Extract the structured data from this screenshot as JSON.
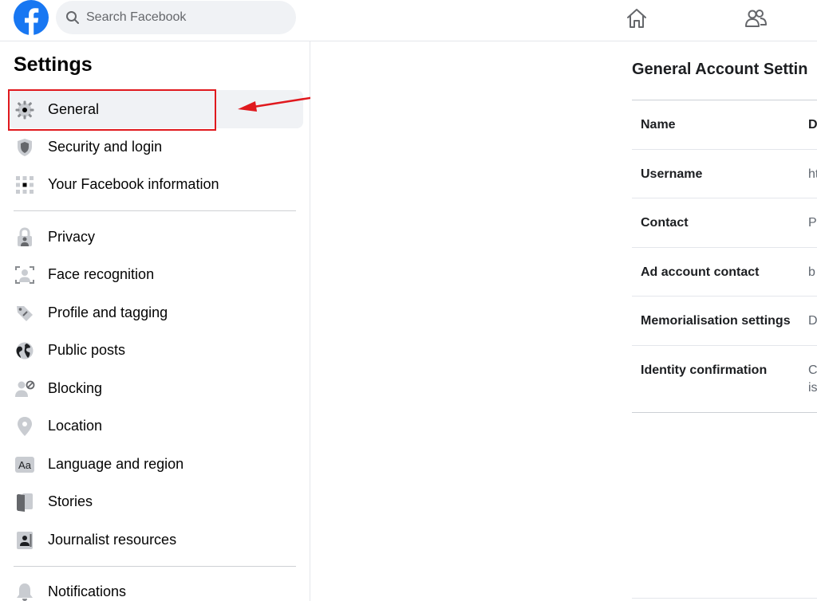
{
  "search": {
    "placeholder": "Search Facebook"
  },
  "sidebar": {
    "title": "Settings",
    "items": [
      {
        "label": "General",
        "icon": "gear-icon"
      },
      {
        "label": "Security and login",
        "icon": "shield-icon"
      },
      {
        "label": "Your Facebook information",
        "icon": "grid-icon"
      },
      {
        "label": "Privacy",
        "icon": "lock-icon"
      },
      {
        "label": "Face recognition",
        "icon": "face-scan-icon"
      },
      {
        "label": "Profile and tagging",
        "icon": "tag-icon"
      },
      {
        "label": "Public posts",
        "icon": "globe-icon"
      },
      {
        "label": "Blocking",
        "icon": "block-user-icon"
      },
      {
        "label": "Location",
        "icon": "location-pin-icon"
      },
      {
        "label": "Language and region",
        "icon": "language-icon"
      },
      {
        "label": "Stories",
        "icon": "stories-icon"
      },
      {
        "label": "Journalist resources",
        "icon": "journalist-icon"
      },
      {
        "label": "Notifications",
        "icon": "bell-icon"
      }
    ]
  },
  "main": {
    "title": "General Account Settin",
    "rows": [
      {
        "label": "Name",
        "value": "D"
      },
      {
        "label": "Username",
        "value": "ht"
      },
      {
        "label": "Contact",
        "value": "P"
      },
      {
        "label": "Ad account contact",
        "value": "b"
      },
      {
        "label": "Memorialisation settings",
        "value": "D"
      },
      {
        "label": "Identity confirmation",
        "value": "C",
        "value2": "is"
      }
    ]
  },
  "colors": {
    "brand": "#1877f2",
    "annotation": "#e0191e",
    "active_bg": "#f0f2f5"
  }
}
